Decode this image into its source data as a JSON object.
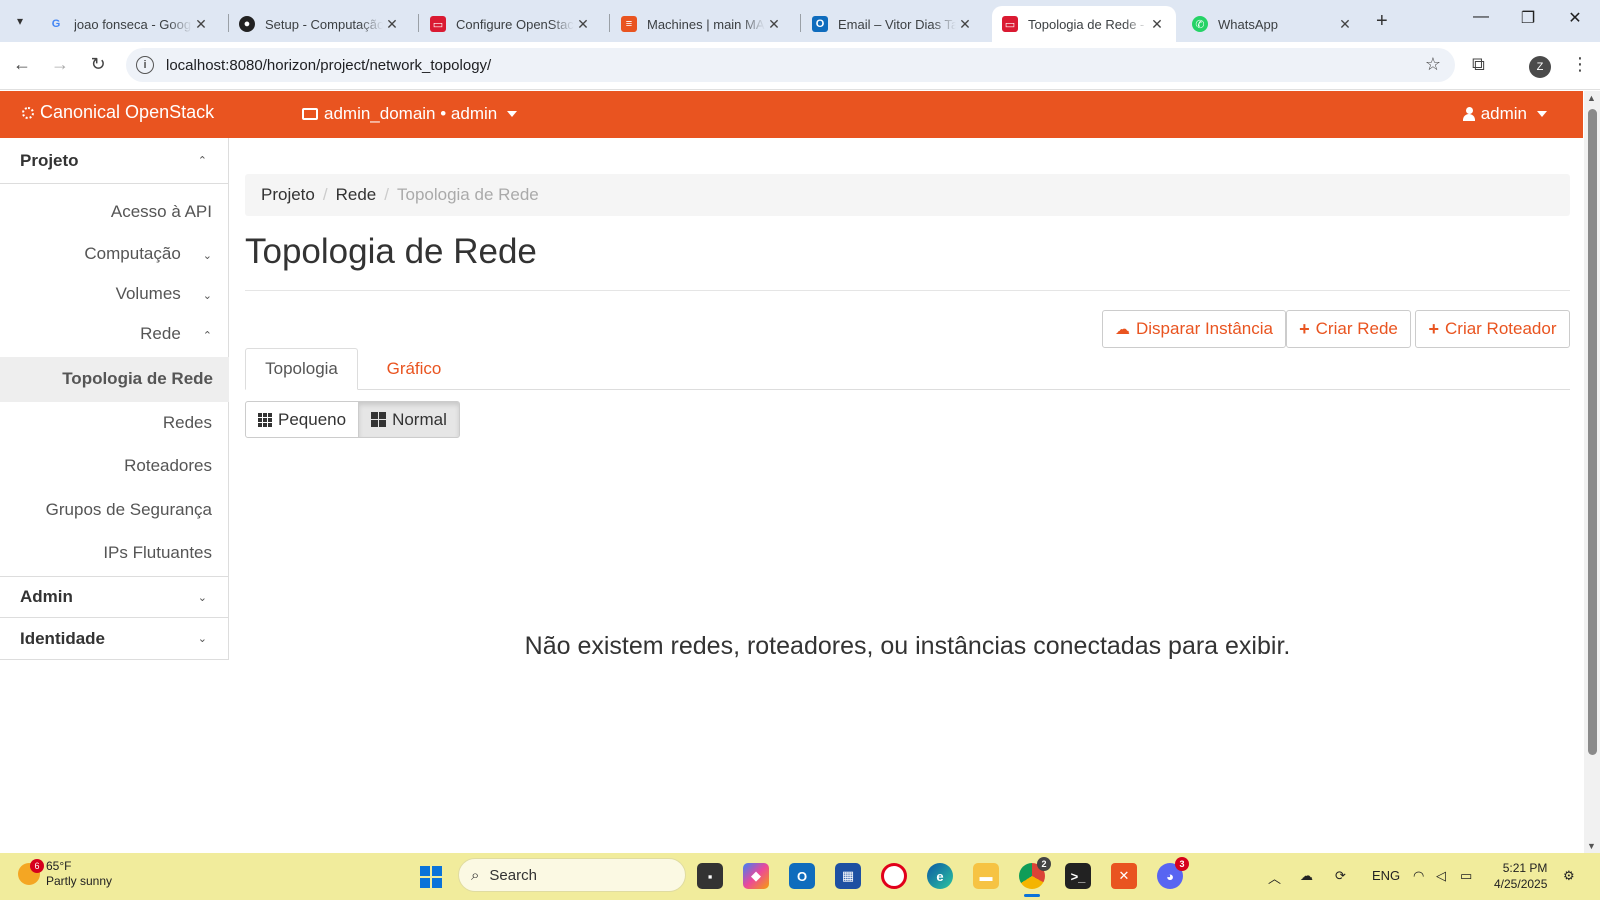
{
  "browser": {
    "tabs": [
      {
        "title": "joao fonseca - Googl",
        "favicon": "google-icon"
      },
      {
        "title": "Setup - Computação",
        "favicon": "github-icon"
      },
      {
        "title": "Configure OpenStack",
        "favicon": "openstack-icon"
      },
      {
        "title": "Machines | main MA",
        "favicon": "maas-icon"
      },
      {
        "title": "Email – Vitor Dias Ta",
        "favicon": "outlook-icon"
      },
      {
        "title": "Topologia de Rede -",
        "favicon": "openstack-icon"
      },
      {
        "title": "WhatsApp",
        "favicon": "whatsapp-icon"
      }
    ],
    "active_tab": 5,
    "url": "localhost:8080/horizon/project/network_topology/",
    "profile_initial": "Z"
  },
  "header": {
    "brand": "Canonical OpenStack",
    "project_selector": "admin_domain • admin",
    "user": "admin",
    "accent_color": "#e95420"
  },
  "sidebar": {
    "sections": [
      {
        "label": "Projeto",
        "expanded": true
      },
      {
        "label": "Admin",
        "expanded": false
      },
      {
        "label": "Identidade",
        "expanded": false
      }
    ],
    "items": [
      {
        "label": "Acesso à API"
      },
      {
        "label": "Computação",
        "has_chevron": true
      },
      {
        "label": "Volumes",
        "has_chevron": true
      },
      {
        "label": "Rede",
        "has_chevron": true
      },
      {
        "label": "Topologia de Rede",
        "active": true
      },
      {
        "label": "Redes"
      },
      {
        "label": "Roteadores"
      },
      {
        "label": "Grupos de Segurança"
      },
      {
        "label": "IPs Flutuantes"
      }
    ]
  },
  "main": {
    "breadcrumb": [
      "Projeto",
      "Rede",
      "Topologia de Rede"
    ],
    "title": "Topologia de Rede",
    "actions": [
      "Disparar Instância",
      "Criar Rede",
      "Criar Roteador"
    ],
    "tabs": [
      "Topologia",
      "Gráfico"
    ],
    "active_tab": "Topologia",
    "size_buttons": [
      "Pequeno",
      "Normal"
    ],
    "selected_size": "Normal",
    "empty_message": "Não existem redes, roteadores, ou instâncias conectadas para exibir."
  },
  "taskbar": {
    "weather_temp": "65°F",
    "weather_desc": "Partly sunny",
    "weather_badge": "6",
    "search_placeholder": "Search",
    "language": "ENG",
    "time": "5:21 PM",
    "date": "4/25/2025",
    "chrome_badge": "2",
    "discord_badge": "3"
  }
}
